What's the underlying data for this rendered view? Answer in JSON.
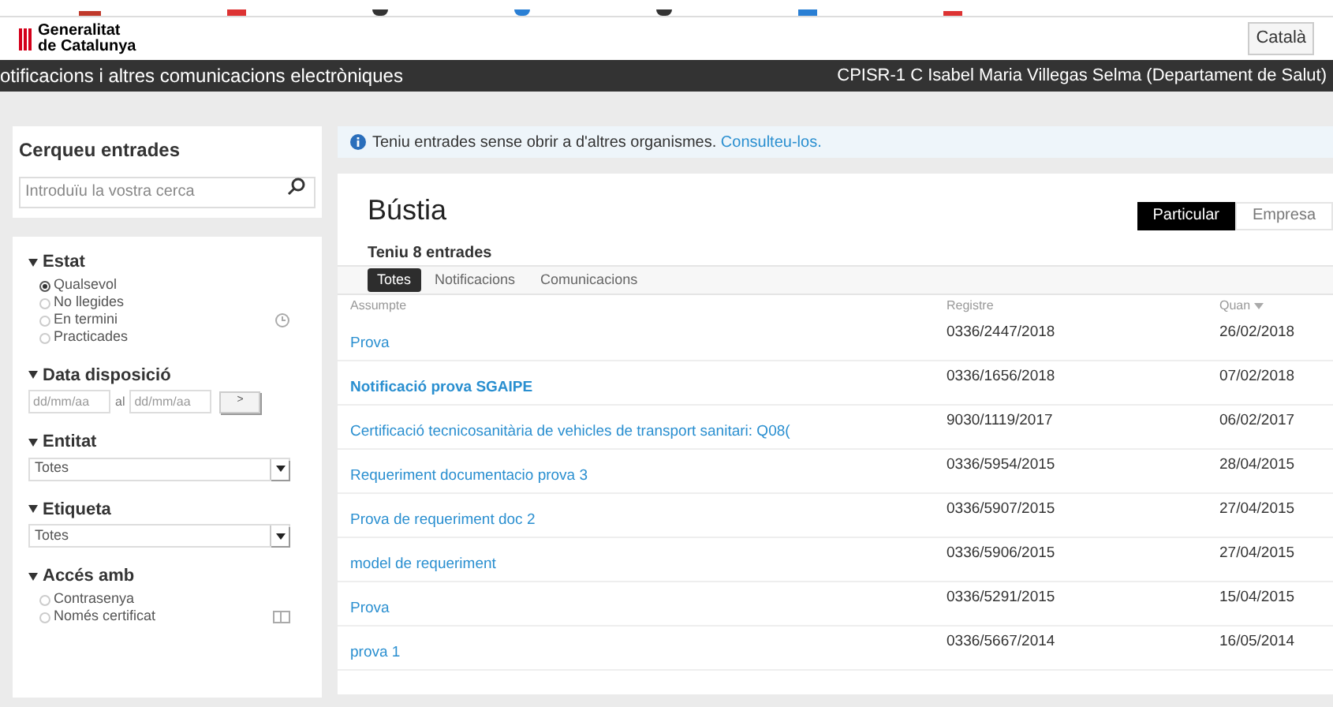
{
  "header": {
    "logo_line_1": "Generalitat",
    "logo_line_2": "de Catalunya",
    "language": "Català"
  },
  "nav_bar": {
    "title": "otificacions i altres comunicacions electròniques",
    "user": "CPISR-1 C Isabel Maria Villegas Selma (Departament de Salut)"
  },
  "search": {
    "title": "Cerqueu entrades",
    "placeholder": "Introduïu la vostra cerca"
  },
  "filters": [
    {
      "kind": "radios",
      "title": "Estat",
      "expanded": true,
      "options": [
        {
          "label": "Qualsevol",
          "selected": true
        },
        {
          "label": "No llegides",
          "selected": false
        },
        {
          "label": "En termini",
          "selected": false
        },
        {
          "label": "Practicades",
          "selected": false
        }
      ]
    },
    {
      "kind": "dates",
      "title": "Data disposició",
      "expanded": true,
      "from_placeholder": "dd/mm/aa",
      "separator": "al",
      "to_placeholder": "dd/mm/aa",
      "button": ">"
    },
    {
      "kind": "select",
      "title": "Entitat",
      "expanded": true,
      "value": "Totes"
    },
    {
      "kind": "select",
      "title": "Etiqueta",
      "expanded": true,
      "value": "Totes"
    },
    {
      "kind": "radios",
      "title": "Accés amb",
      "expanded": true,
      "options": [
        {
          "label": "Contrasenya",
          "selected": false
        },
        {
          "label": "Només certificat",
          "selected": false
        }
      ]
    }
  ],
  "info": {
    "text": "Teniu entrades sense obrir a d'altres organismes.",
    "link": "Consulteu-los."
  },
  "mailbox": {
    "title": "Bústia",
    "modes": [
      {
        "label": "Particular",
        "selected": true
      },
      {
        "label": "Empresa",
        "selected": false
      }
    ],
    "count": "Teniu 8 entrades",
    "tabs": [
      {
        "label": "Totes",
        "selected": true
      },
      {
        "label": "Notificacions",
        "selected": false
      },
      {
        "label": "Comunicacions",
        "selected": false
      }
    ],
    "columns": [
      "Assumpte",
      "Registre",
      "Quan"
    ],
    "rows": [
      {
        "subject": "Prova",
        "registry": "0336/2447/2018",
        "date": "26/02/2018",
        "unread": false
      },
      {
        "subject": "Notificació prova SGAIPE",
        "registry": "0336/1656/2018",
        "date": "07/02/2018",
        "unread": true
      },
      {
        "subject": "Certificació tecnicosanitària de vehicles de transport sanitari: Q08(",
        "registry": "9030/1119/2017",
        "date": "06/02/2017",
        "unread": false
      },
      {
        "subject": "Requeriment documentacio prova 3",
        "registry": "0336/5954/2015",
        "date": "28/04/2015",
        "unread": false
      },
      {
        "subject": "Prova de requeriment doc 2",
        "registry": "0336/5907/2015",
        "date": "27/04/2015",
        "unread": false
      },
      {
        "subject": "model de requeriment",
        "registry": "0336/5906/2015",
        "date": "27/04/2015",
        "unread": false
      },
      {
        "subject": "Prova",
        "registry": "0336/5291/2015",
        "date": "15/04/2015",
        "unread": false
      },
      {
        "subject": "prova 1",
        "registry": "0336/5667/2014",
        "date": "16/05/2014",
        "unread": false
      }
    ]
  }
}
